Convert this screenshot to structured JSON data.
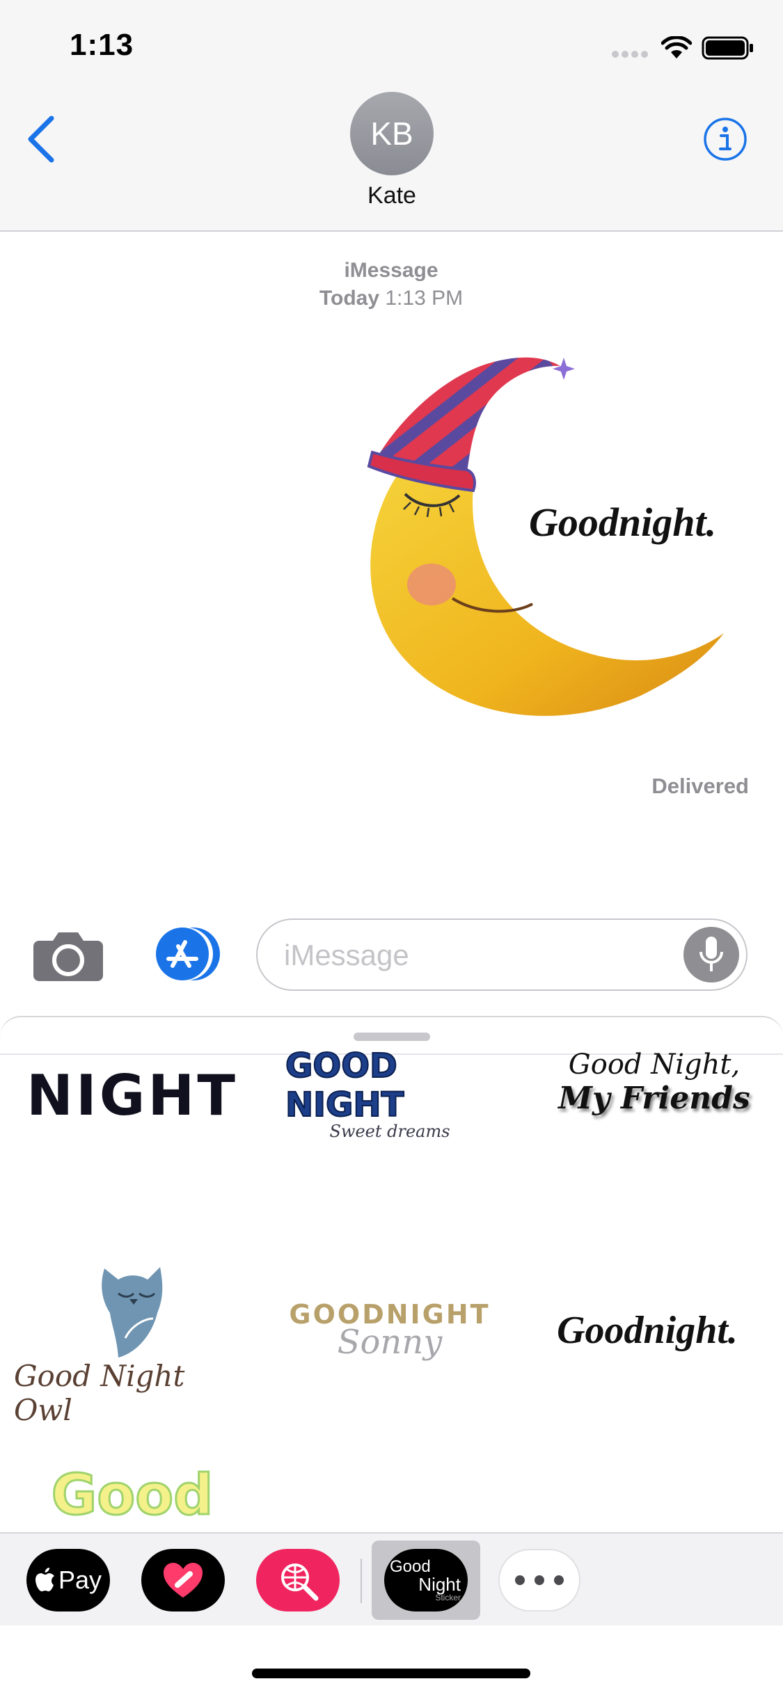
{
  "status_bar": {
    "time": "1:13"
  },
  "nav": {
    "contact_initials": "KB",
    "contact_name": "Kate"
  },
  "conversation": {
    "service": "iMessage",
    "date_label": "Today",
    "time_label": "1:13 PM",
    "status": "Delivered",
    "sticker_text": "Goodnight."
  },
  "compose": {
    "placeholder": "iMessage"
  },
  "sticker_grid": {
    "items": [
      {
        "text": "NIGHT"
      },
      {
        "text": "GOOD NIGHT",
        "subtext": "Sweet dreams"
      },
      {
        "text": "Good Night,",
        "subtext": "My Friends"
      },
      {
        "text": "Good Night Owl"
      },
      {
        "text": "GOODNIGHT",
        "subtext": "Sonny"
      },
      {
        "text": "Goodnight."
      },
      {
        "text": "Good"
      }
    ]
  },
  "app_drawer": {
    "apple_pay_label": "Pay",
    "active_app_line1": "Good",
    "active_app_line2": "Night",
    "active_app_line3": "Sticker"
  },
  "colors": {
    "accent": "#1a74e8",
    "hat_red": "#e0384f",
    "hat_purple": "#5a4a9f",
    "moon": "#f2c41a"
  }
}
